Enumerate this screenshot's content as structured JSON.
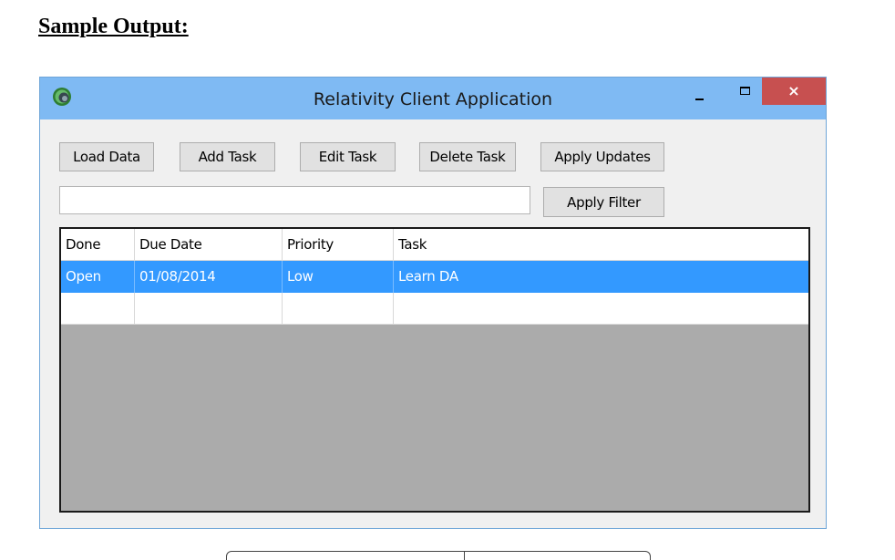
{
  "page": {
    "heading": "Sample Output:"
  },
  "window": {
    "title": "Relativity Client Application",
    "close_label": "×",
    "toolbar": {
      "load_data": "Load Data",
      "add_task": "Add Task",
      "edit_task": "Edit Task",
      "delete_task": "Delete Task",
      "apply_updates": "Apply Updates",
      "apply_filter": "Apply Filter"
    },
    "filter": {
      "value": ""
    },
    "grid": {
      "columns": [
        "Done",
        "Due Date",
        "Priority",
        "Task"
      ],
      "rows": [
        [
          "Open",
          "01/08/2014",
          "Low",
          "Learn DA"
        ]
      ]
    }
  },
  "icons": {
    "app": "app-logo-icon",
    "minimize": "minimize-icon",
    "maximize": "maximize-icon",
    "close": "close-icon"
  },
  "colors": {
    "titlebar": "#7fbaf3",
    "selection": "#3399ff",
    "close_button": "#c75050",
    "grid_background": "#ababab"
  }
}
